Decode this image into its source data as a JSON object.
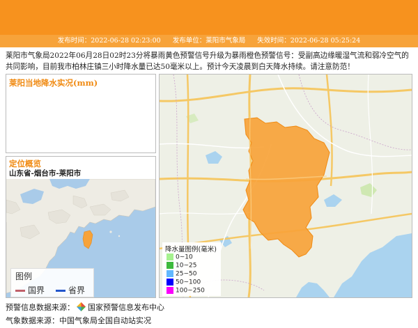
{
  "header": {
    "publish_time": "发布时间：2022-06-28 02:23:00",
    "publisher": "发布单位：莱阳市气象局",
    "expire_time": "失效时间：2022-06-28 05:25:24"
  },
  "description": "莱阳市气象局2022年06月28日02时23分将暴雨黄色预警信号升级为暴雨橙色预警信号：受副高边缘暖湿气流和弱冷空气的共同影响，目前我市柏林庄镇三小时降水量已达50毫米以上。预计今天凌晨到白天降水持续。请注意防范！",
  "rain_panel": {
    "title": "莱阳当地降水实况(mm)"
  },
  "location": {
    "title": "定位概览",
    "path": "山东省-烟台市-莱阳市",
    "legend_title": "图例",
    "legend_items": [
      {
        "label": "国界",
        "color": "#c0606a"
      },
      {
        "label": "省界",
        "color": "#2255cc"
      }
    ]
  },
  "rain_legend": {
    "title": "降水量图例(毫米)",
    "items": [
      {
        "label": "0~10",
        "color": "#a6f28f"
      },
      {
        "label": "10~25",
        "color": "#3dba3d"
      },
      {
        "label": "25~50",
        "color": "#61b8ff"
      },
      {
        "label": "50~100",
        "color": "#0000fe"
      },
      {
        "label": "100~250",
        "color": "#fa00fa"
      }
    ]
  },
  "footer": {
    "source1_prefix": "预警信息数据来源：",
    "source1_name": "国家预警信息发布中心",
    "source2": "气象数据来源：中国气象局全国自动站实况"
  },
  "colors": {
    "banner": "#f7921e",
    "warning_area": "#f7a33a",
    "title_accent": "#f08a12"
  }
}
